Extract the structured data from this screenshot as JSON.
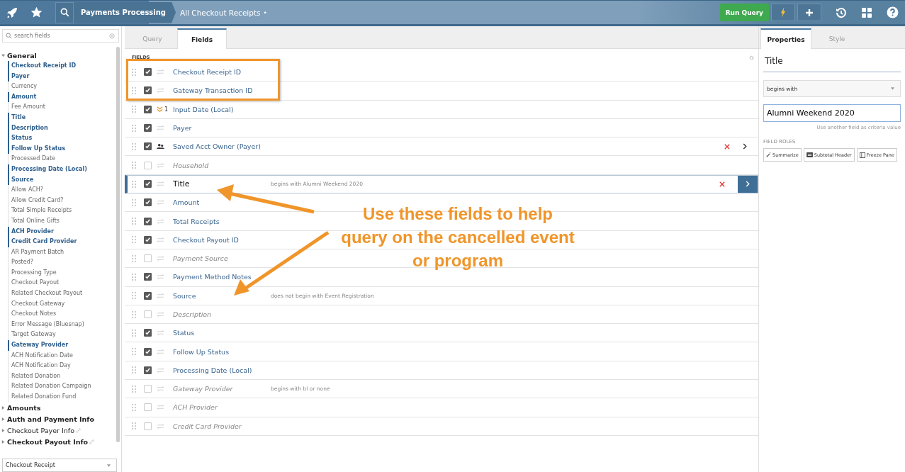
{
  "topbar": {
    "breadcrumb": "Payments Processing",
    "title": "All Checkout Receipts",
    "unsaved_mark": "•",
    "run_button": "Run Query"
  },
  "sidebar": {
    "search": {
      "placeholder": "search fields"
    },
    "groups": [
      {
        "label": "General",
        "expanded": true,
        "in_query": true,
        "linked": false,
        "children": [
          {
            "label": "Checkout Receipt ID",
            "in_query": true
          },
          {
            "label": "Payer",
            "in_query": true
          },
          {
            "label": "Currency",
            "in_query": false
          },
          {
            "label": "Amount",
            "in_query": true
          },
          {
            "label": "Fee Amount",
            "in_query": false
          },
          {
            "label": "Title",
            "in_query": true
          },
          {
            "label": "Description",
            "in_query": true
          },
          {
            "label": "Status",
            "in_query": true
          },
          {
            "label": "Follow Up Status",
            "in_query": true
          },
          {
            "label": "Processed Date",
            "in_query": false
          },
          {
            "label": "Processing Date (Local)",
            "in_query": true
          },
          {
            "label": "Source",
            "in_query": true
          },
          {
            "label": "Allow ACH?",
            "in_query": false
          },
          {
            "label": "Allow Credit Card?",
            "in_query": false
          },
          {
            "label": "Total Simple Receipts",
            "in_query": false
          },
          {
            "label": "Total Online Gifts",
            "in_query": false
          },
          {
            "label": "ACH Provider",
            "in_query": true
          },
          {
            "label": "Credit Card Provider",
            "in_query": true
          },
          {
            "label": "AR Payment Batch",
            "in_query": false
          },
          {
            "label": "Posted?",
            "in_query": false
          },
          {
            "label": "Processing Type",
            "in_query": false
          },
          {
            "label": "Checkout Payout",
            "in_query": false
          },
          {
            "label": "Related Checkout Payout",
            "in_query": false
          },
          {
            "label": "Checkout Gateway",
            "in_query": false
          },
          {
            "label": "Checkout Notes",
            "in_query": false
          },
          {
            "label": "Error Message (Bluesnap)",
            "in_query": false
          },
          {
            "label": "Target Gateway",
            "in_query": false
          },
          {
            "label": "Gateway Provider",
            "in_query": true
          },
          {
            "label": "ACH Notification Date",
            "in_query": false
          },
          {
            "label": "ACH Notification Day",
            "in_query": false
          },
          {
            "label": "Related Donation",
            "in_query": false
          },
          {
            "label": "Related Donation Campaign",
            "in_query": false
          },
          {
            "label": "Related Donation Fund",
            "in_query": false
          }
        ]
      },
      {
        "label": "Amounts",
        "expanded": false,
        "in_query": true,
        "linked": false
      },
      {
        "label": "Auth and Payment Info",
        "expanded": false,
        "in_query": true,
        "linked": false
      },
      {
        "label": "Checkout Payer Info",
        "expanded": false,
        "in_query": false,
        "linked": true
      },
      {
        "label": "Checkout Payout Info",
        "expanded": false,
        "in_query": true,
        "linked": true
      }
    ],
    "record_type": "Checkout Receipt"
  },
  "center": {
    "tabs": [
      {
        "label": "Query",
        "selected": false
      },
      {
        "label": "Fields",
        "selected": true
      }
    ],
    "section_label": "FIELDS",
    "fields": [
      {
        "name": "Checkout Receipt ID",
        "checked": true,
        "kind": "sort",
        "highlighted": true,
        "removable": false,
        "selected": false
      },
      {
        "name": "Gateway Transaction ID",
        "checked": true,
        "kind": "sort",
        "highlighted": true,
        "removable": false,
        "selected": false
      },
      {
        "name": "Input Date (Local)",
        "checked": true,
        "kind": "sort-desc",
        "sort_order": "1",
        "highlighted": false,
        "removable": false,
        "selected": false
      },
      {
        "name": "Payer",
        "checked": true,
        "kind": "sort",
        "highlighted": false,
        "removable": false,
        "selected": false
      },
      {
        "name": "Saved Acct Owner (Payer)",
        "checked": true,
        "kind": "link",
        "highlighted": false,
        "removable": true,
        "selected": false
      },
      {
        "name": "Household",
        "checked": false,
        "kind": "sort",
        "highlighted": false,
        "removable": false,
        "selected": false
      },
      {
        "name": "Title",
        "checked": true,
        "kind": "sort",
        "criteria": "begins with Alumni Weekend 2020",
        "highlighted": false,
        "removable": true,
        "selected": true
      },
      {
        "name": "Amount",
        "checked": true,
        "kind": "sort",
        "highlighted": false,
        "removable": false,
        "selected": false
      },
      {
        "name": "Total Receipts",
        "checked": true,
        "kind": "sort",
        "highlighted": false,
        "removable": false,
        "selected": false
      },
      {
        "name": "Checkout Payout ID",
        "checked": true,
        "kind": "sort",
        "highlighted": false,
        "removable": false,
        "selected": false
      },
      {
        "name": "Payment Source",
        "checked": false,
        "kind": "sort",
        "highlighted": false,
        "removable": false,
        "selected": false
      },
      {
        "name": "Payment Method Notes",
        "checked": true,
        "kind": "sort",
        "highlighted": false,
        "removable": false,
        "selected": false
      },
      {
        "name": "Source",
        "checked": true,
        "kind": "sort",
        "criteria": "does not begin with Event Registration",
        "highlighted": false,
        "removable": false,
        "selected": false
      },
      {
        "name": "Description",
        "checked": false,
        "kind": "sort",
        "highlighted": false,
        "removable": false,
        "selected": false
      },
      {
        "name": "Status",
        "checked": true,
        "kind": "sort",
        "highlighted": false,
        "removable": false,
        "selected": false
      },
      {
        "name": "Follow Up Status",
        "checked": true,
        "kind": "sort",
        "highlighted": false,
        "removable": false,
        "selected": false
      },
      {
        "name": "Processing Date (Local)",
        "checked": true,
        "kind": "sort",
        "highlighted": false,
        "removable": false,
        "selected": false
      },
      {
        "name": "Gateway Provider",
        "checked": false,
        "kind": "sort",
        "criteria": "begins with bl or none",
        "highlighted": false,
        "removable": false,
        "selected": false
      },
      {
        "name": "ACH Provider",
        "checked": false,
        "kind": "sort",
        "highlighted": false,
        "removable": false,
        "selected": false
      },
      {
        "name": "Credit Card Provider",
        "checked": false,
        "kind": "sort",
        "highlighted": false,
        "removable": false,
        "selected": false
      }
    ],
    "annotation": "Use these fields to help query on the cancelled event or program"
  },
  "properties": {
    "tabs": [
      {
        "label": "Properties",
        "selected": true
      },
      {
        "label": "Style",
        "selected": false
      }
    ],
    "field_title": "Title",
    "operator": "begins with",
    "value": "Alumni Weekend 2020",
    "hint": "Use another field as criteria value",
    "roles_label": "FIELD ROLES",
    "roles": [
      {
        "label": "Summarize",
        "kind": "summarize"
      },
      {
        "label": "Subtotal Header",
        "kind": "subtotal"
      },
      {
        "label": "Freeze Pane",
        "kind": "freeze"
      }
    ]
  }
}
